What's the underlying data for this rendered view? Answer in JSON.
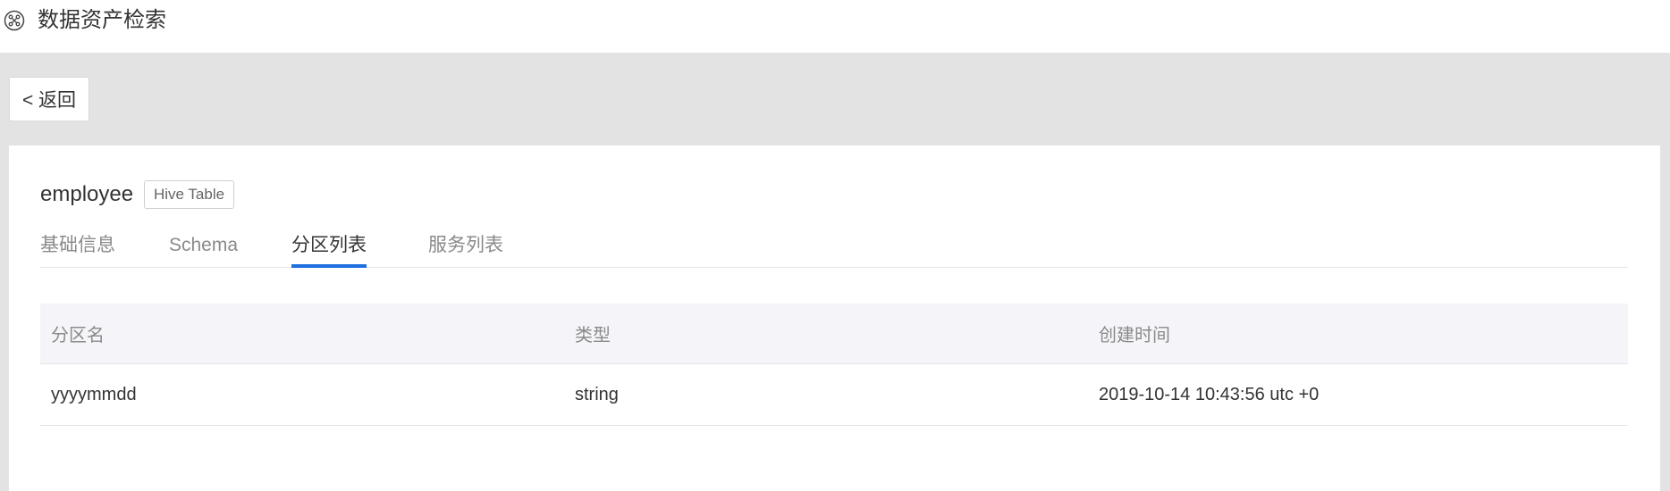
{
  "header": {
    "title": "数据资产检索",
    "icon": "network-icon"
  },
  "back_button": {
    "label": "< 返回"
  },
  "asset": {
    "name": "employee",
    "type_badge": "Hive Table"
  },
  "tabs": [
    {
      "label": "基础信息",
      "active": false
    },
    {
      "label": "Schema",
      "active": false
    },
    {
      "label": "分区列表",
      "active": true
    },
    {
      "label": "服务列表",
      "active": false
    }
  ],
  "partition_table": {
    "columns": [
      "分区名",
      "类型",
      "创建时间"
    ],
    "rows": [
      [
        "yyyymmdd",
        "string",
        "2019-10-14 10:43:56 utc +0"
      ]
    ]
  },
  "colors": {
    "accent": "#1e6fe0",
    "page_background": "#e3e3e3",
    "table_header_background": "#f5f5f9"
  }
}
